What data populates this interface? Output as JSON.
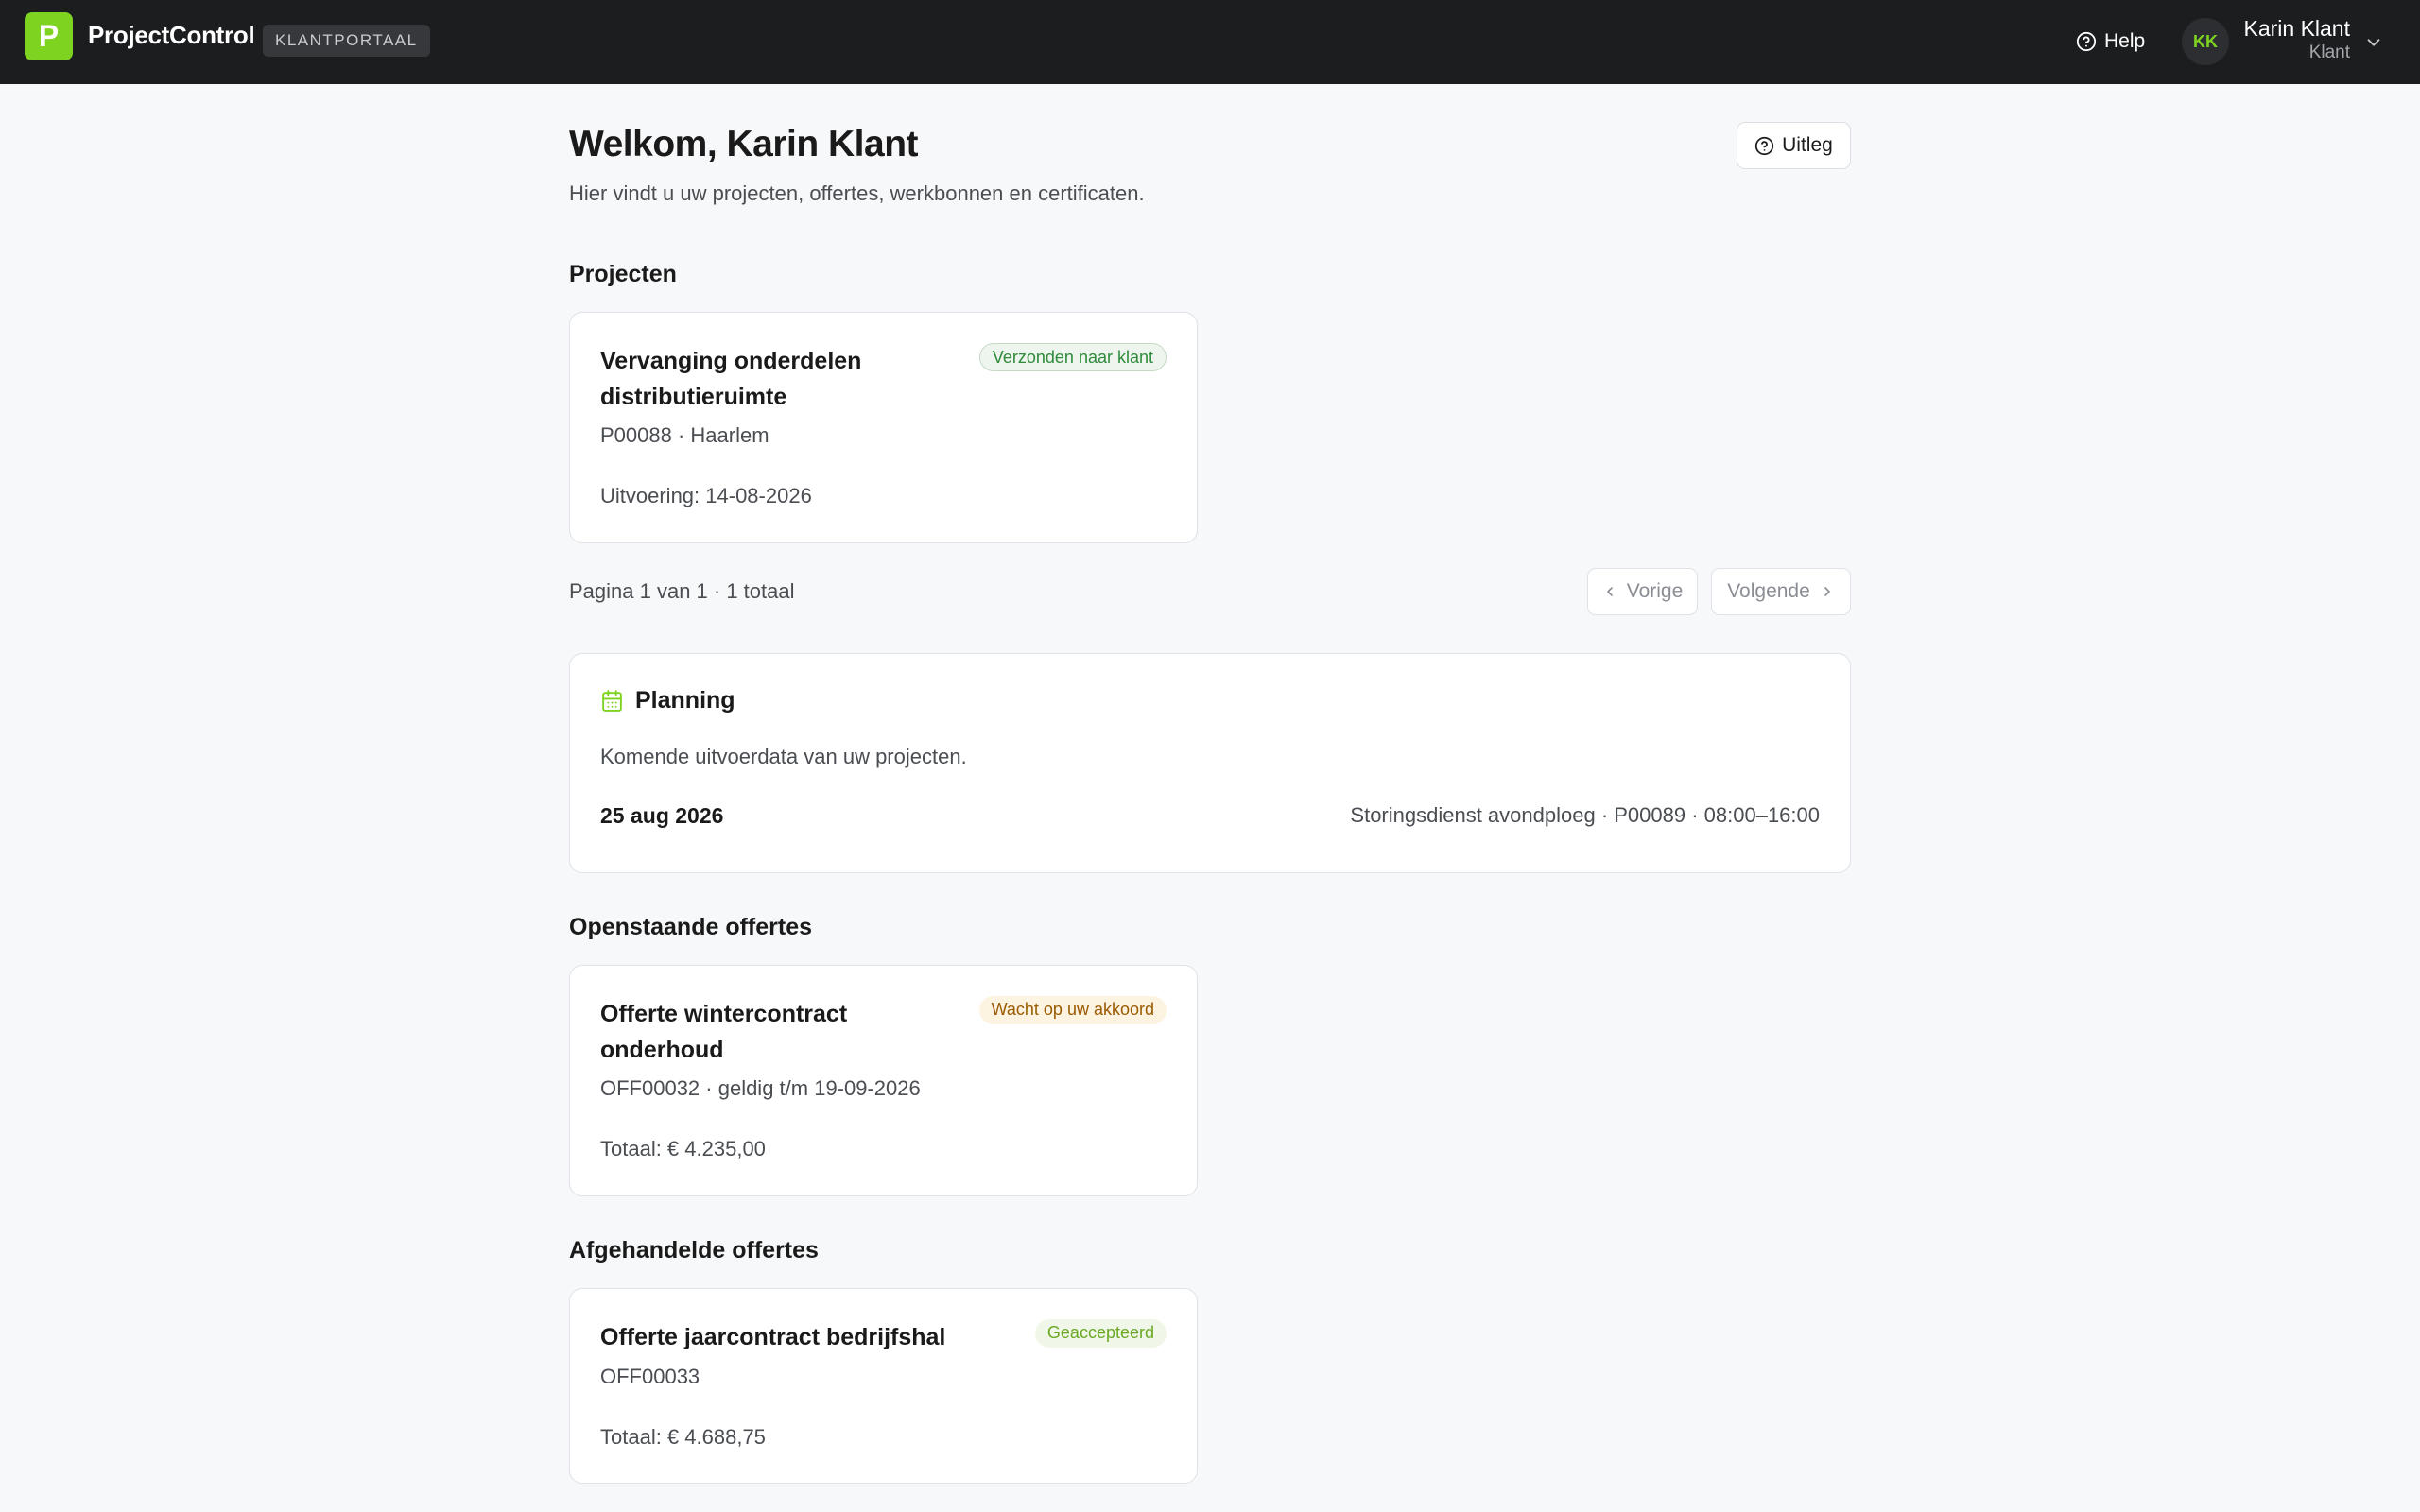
{
  "header": {
    "logo_letter": "P",
    "app_name": "ProjectControl",
    "portal_badge": "KLANTPORTAAL",
    "help_label": "Help",
    "user": {
      "initials": "KK",
      "name": "Karin Klant",
      "role": "Klant"
    }
  },
  "page": {
    "title": "Welkom, Karin Klant",
    "subtitle": "Hier vindt u uw projecten, offertes, werkbonnen en certificaten.",
    "uitleg_label": "Uitleg"
  },
  "projects": {
    "heading": "Projecten",
    "items": [
      {
        "title_line1": "Vervanging onderdelen",
        "title_line2": "distributieruimte",
        "status": "Verzonden naar klant",
        "meta": "P00088 · Haarlem",
        "execution": "Uitvoering: 14-08-2026"
      }
    ],
    "pagination": {
      "text": "Pagina 1 van 1 · 1 totaal",
      "prev_label": "Vorige",
      "next_label": "Volgende"
    }
  },
  "planning": {
    "title": "Planning",
    "description": "Komende uitvoerdata van uw projecten.",
    "entries": [
      {
        "date": "25 aug 2026",
        "detail": "Storingsdienst avondploeg · P00089 · 08:00–16:00"
      }
    ]
  },
  "open_quotes": {
    "heading": "Openstaande offertes",
    "items": [
      {
        "title_line1": "Offerte wintercontract",
        "title_line2": "onderhoud",
        "status": "Wacht op uw akkoord",
        "meta": "OFF00032 · geldig t/m 19-09-2026",
        "total": "Totaal: € 4.235,00"
      }
    ]
  },
  "closed_quotes": {
    "heading": "Afgehandelde offertes",
    "items": [
      {
        "title": "Offerte jaarcontract bedrijfshal",
        "status": "Geaccepteerd",
        "meta": "OFF00033",
        "total": "Totaal: € 4.688,75"
      }
    ]
  },
  "colors": {
    "brand": "#7ed321",
    "topbar": "#1c1d1f",
    "background": "#f7f8f9",
    "status_sent": "#2e8b3a",
    "status_waiting": "#9a5a00",
    "status_accepted": "#6aa823"
  },
  "icons": {
    "help": "question-circle-icon",
    "user_menu": "chevron-down-icon",
    "uitleg": "question-circle-icon",
    "prev": "chevron-left-icon",
    "next": "chevron-right-icon",
    "planning": "calendar-icon"
  }
}
